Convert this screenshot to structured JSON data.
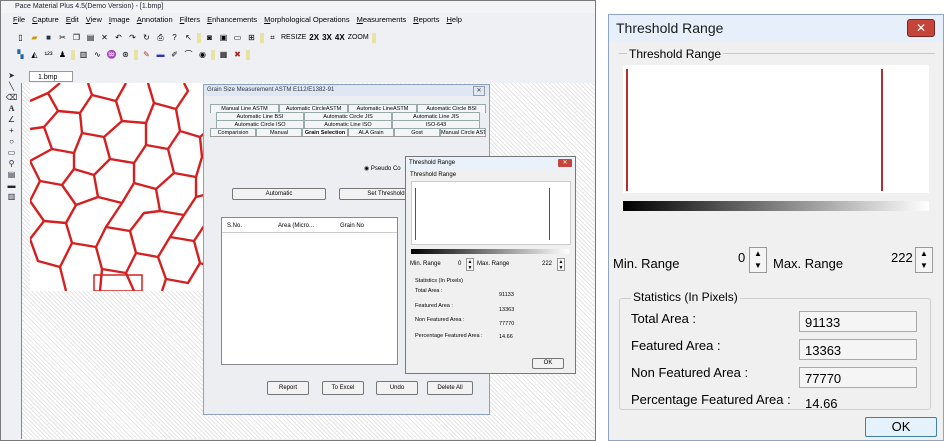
{
  "app": {
    "title": "Pace Material Plus 4.5(Demo Version) - [1.bmp]",
    "menu": [
      "File",
      "Capture",
      "Edit",
      "View",
      "Image",
      "Annotation",
      "Filters",
      "Enhancements",
      "Morphological Operations",
      "Measurements",
      "Reports",
      "Help"
    ],
    "toolbar": {
      "resize": "RESIZE",
      "x2": "2X",
      "x3": "3X",
      "x4": "4X",
      "zoom": "ZOOM"
    },
    "doc_tab": "1.bmp"
  },
  "grain_dialog": {
    "title": "Grain Size Measurement ASTM E112/E1382-91",
    "tab_rows": [
      [
        "Manual Line ASTM",
        "Automatic CircleASTM",
        "Automatic LineASTM",
        "Automatic Circle BSI"
      ],
      [
        "Automatic Line BSI",
        "Automatic Circle JIS",
        "Automatic Line JIS"
      ],
      [
        "Automatic Circle ISO",
        "Automatic Line ISO",
        "ISO-643"
      ],
      [
        "Comparision",
        "Manual",
        "Grain Selection",
        "ALA Grain",
        "Gost",
        "Manual Circle ASTM"
      ]
    ],
    "active_tab": "Grain Selection",
    "radio_label": "Pseudo Co",
    "automatic_button": "Automatic",
    "set_threshold_button": "Set Threshold",
    "columns": [
      "S.No.",
      "Area (Micro...",
      "Grain No"
    ],
    "buttons": {
      "report": "Report",
      "excel": "To Excel",
      "undo": "Undo",
      "delete_all": "Delete All"
    }
  },
  "threshold": {
    "title": "Threshold Range",
    "group": "Threshold Range",
    "min_label": "Min. Range",
    "min_value": "0",
    "max_label": "Max. Range",
    "max_value": "222",
    "stats_group": "Statistics (In Pixels)",
    "total_label": "Total Area :",
    "total_value": "91133",
    "featured_label": "Featured Area :",
    "featured_value": "13363",
    "nonfeatured_label": "Non Featured Area :",
    "nonfeatured_value": "77770",
    "percent_label": "Percentage Featured Area :",
    "percent_value": "14.66",
    "ok": "OK"
  },
  "colors": {
    "grain_boundary": "#d42020",
    "close_button": "#c5453a",
    "threshold_line": "#b03030"
  }
}
